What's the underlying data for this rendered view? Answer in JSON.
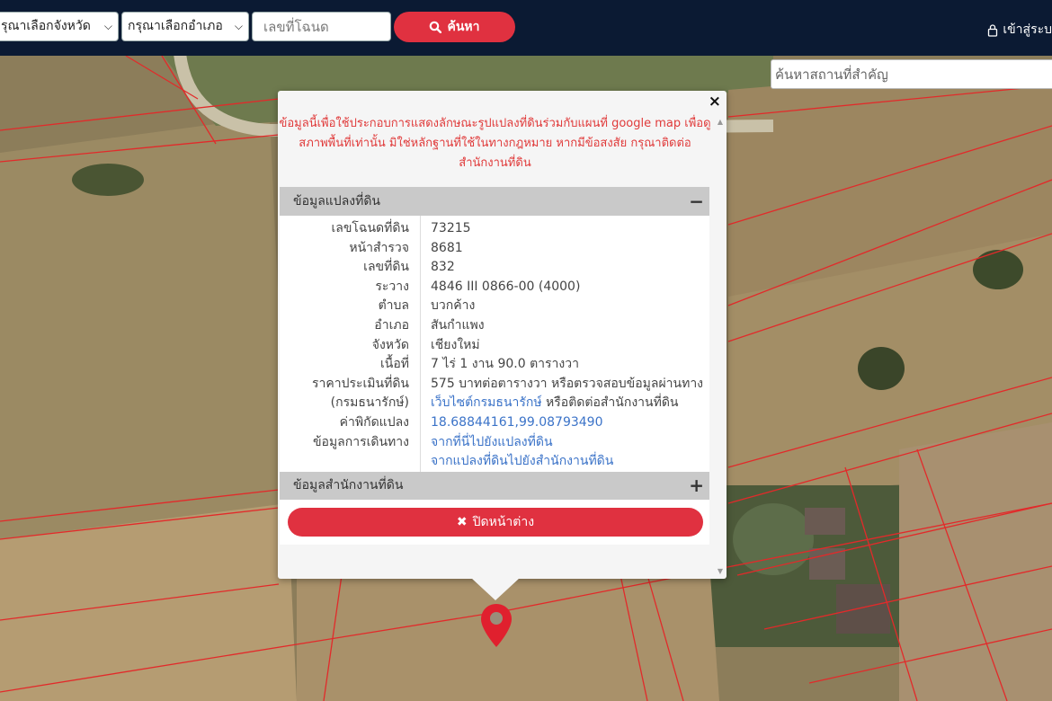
{
  "colors": {
    "nav_bg": "#0b1a33",
    "accent_red": "#e03140",
    "link_blue": "#3b73c8",
    "disclaimer_red": "#e03a3a"
  },
  "topnav": {
    "province_select": "รุณาเลือกจังหวัด",
    "district_select": "กรุณาเลือกอำเภอ",
    "deed_placeholder": "เลขที่โฉนด",
    "search_label": "ค้นหา",
    "login_label": "เข้าสู่ระบ"
  },
  "landmark_placeholder": "ค้นหาสถานที่สำคัญ",
  "popup": {
    "close_symbol": "×",
    "disclaimer": "ข้อมูลนี้เพื่อใช้ประกอบการแสดงลักษณะรูปแปลงที่ดินร่วมกับแผนที่ google map เพื่อดูสภาพพื้นที่เท่านั้น มิใช่หลักฐานที่ใช้ในทางกฎหมาย หากมีข้อสงสัย กรุณาติดต่อสำนักงานที่ดิน",
    "land_section": {
      "title": "ข้อมูลแปลงที่ดิน",
      "toggle": "−",
      "rows": [
        {
          "label": "เลขโฉนดที่ดิน",
          "value": "73215"
        },
        {
          "label": "หน้าสำรวจ",
          "value": "8681"
        },
        {
          "label": "เลขที่ดิน",
          "value": "832"
        },
        {
          "label": "ระวาง",
          "value": "4846 III 0866-00 (4000)"
        },
        {
          "label": "ตำบล",
          "value": "บวกค้าง"
        },
        {
          "label": "อำเภอ",
          "value": "สันกำแพง"
        },
        {
          "label": "จังหวัด",
          "value": "เชียงใหม่"
        },
        {
          "label": "เนื้อที่",
          "value": "7 ไร่ 1 งาน 90.0 ตารางวา"
        },
        {
          "label": "ราคาประเมินที่ดิน",
          "value": "575 บาทต่อตารางวา หรือตรวจสอบข้อมูลผ่านทาง"
        },
        {
          "label": "(กรมธนารักษ์)",
          "link": "เว็บไซต์กรมธนารักษ์",
          "value": " หรือติดต่อสำนักงานที่ดิน"
        },
        {
          "label": "ค่าพิกัดแปลง",
          "link": "18.68844161,99.08793490"
        },
        {
          "label": "ข้อมูลการเดินทาง",
          "link": "จากที่นี่ไปยังแปลงที่ดิน"
        },
        {
          "label": "",
          "link": "จากแปลงที่ดินไปยังสำนักงานที่ดิน"
        }
      ]
    },
    "office_section": {
      "title": "ข้อมูลสำนักงานที่ดิน",
      "toggle": "+"
    },
    "close_window_label": "ปิดหน้าต่าง"
  }
}
